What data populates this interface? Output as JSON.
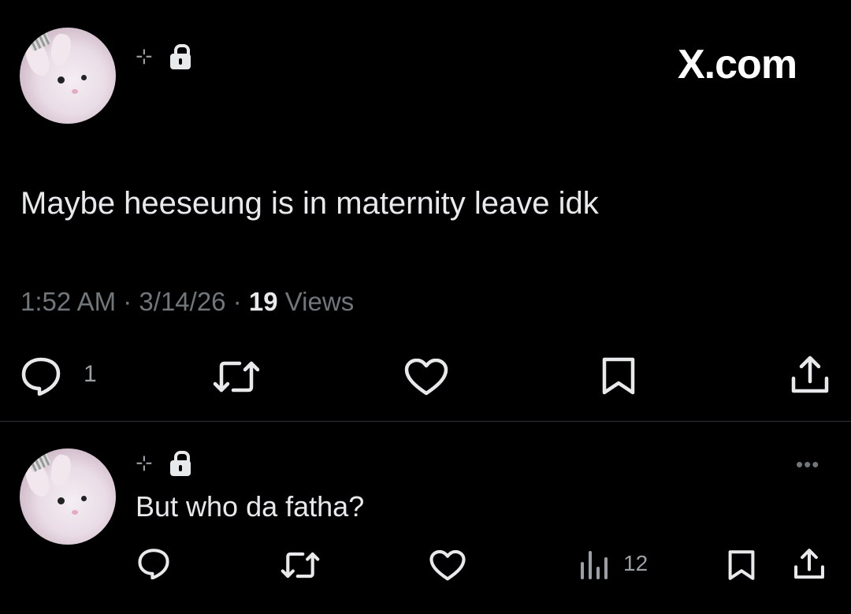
{
  "brand": {
    "label": "X.com"
  },
  "tweet": {
    "text": "Maybe heeseung is in maternity leave idk",
    "time": "1:52 AM",
    "sep1": "·",
    "date": "3/14/26",
    "sep2": "·",
    "views_count": "19",
    "views_label": "Views",
    "reply_count": "1"
  },
  "reply": {
    "text": "But who da fatha?",
    "views_count": "12",
    "more_label": "•••"
  },
  "colors": {
    "background": "#000000",
    "text": "#e7e9ea",
    "muted": "#71767b",
    "divider": "#2f3336"
  }
}
